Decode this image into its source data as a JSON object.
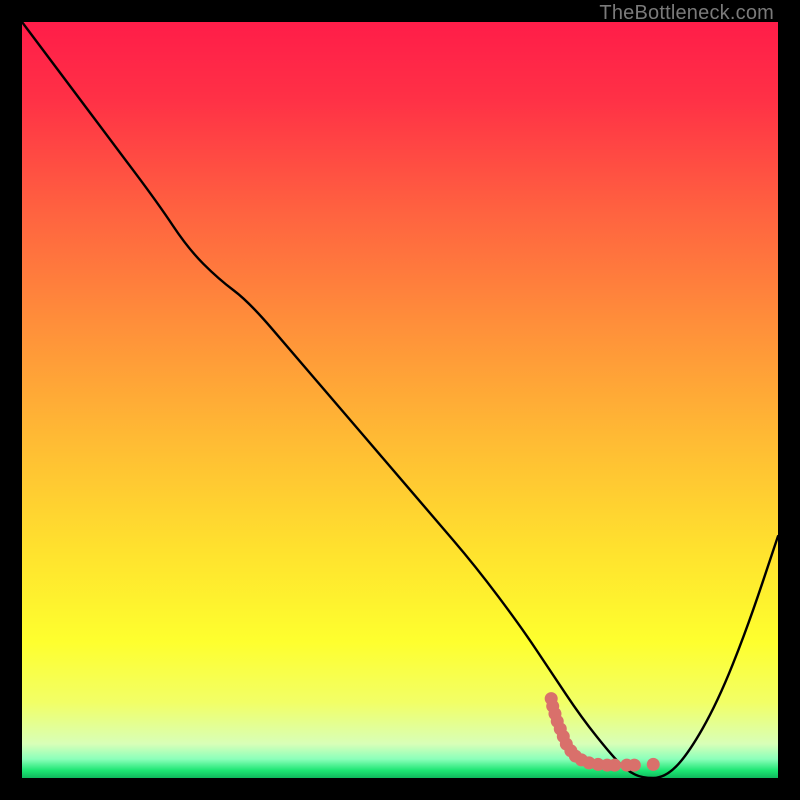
{
  "watermark": {
    "text": "TheBottleneck.com"
  },
  "chart_data": {
    "type": "line",
    "title": "",
    "xlabel": "",
    "ylabel": "",
    "xlim": [
      0,
      100
    ],
    "ylim": [
      0,
      100
    ],
    "grid": false,
    "legend": false,
    "series": [
      {
        "name": "bottleneck-curve",
        "x": [
          0,
          6,
          12,
          18,
          22,
          26,
          30,
          36,
          42,
          48,
          54,
          60,
          66,
          70,
          74,
          78,
          80,
          82,
          85,
          88,
          92,
          96,
          100
        ],
        "y": [
          100,
          92,
          84,
          76,
          70,
          66,
          63,
          56,
          49,
          42,
          35,
          28,
          20,
          14,
          8,
          3,
          1,
          0,
          0,
          3,
          10,
          20,
          32
        ]
      }
    ],
    "markers": {
      "name": "highlight-dots",
      "color": "#d9706b",
      "points": [
        {
          "x": 70.0,
          "y": 10.5
        },
        {
          "x": 70.2,
          "y": 9.5
        },
        {
          "x": 70.5,
          "y": 8.5
        },
        {
          "x": 70.8,
          "y": 7.5
        },
        {
          "x": 71.2,
          "y": 6.5
        },
        {
          "x": 71.6,
          "y": 5.5
        },
        {
          "x": 72.0,
          "y": 4.5
        },
        {
          "x": 72.6,
          "y": 3.6
        },
        {
          "x": 73.2,
          "y": 2.9
        },
        {
          "x": 74.0,
          "y": 2.4
        },
        {
          "x": 75.0,
          "y": 2.0
        },
        {
          "x": 76.2,
          "y": 1.8
        },
        {
          "x": 77.4,
          "y": 1.7
        },
        {
          "x": 78.4,
          "y": 1.7
        },
        {
          "x": 80.0,
          "y": 1.7
        },
        {
          "x": 81.0,
          "y": 1.7
        },
        {
          "x": 83.5,
          "y": 1.8
        }
      ]
    },
    "background_gradient": {
      "stops": [
        {
          "offset": 0.0,
          "color": "#ff1d49"
        },
        {
          "offset": 0.1,
          "color": "#ff3046"
        },
        {
          "offset": 0.25,
          "color": "#ff6240"
        },
        {
          "offset": 0.4,
          "color": "#ff8f3a"
        },
        {
          "offset": 0.55,
          "color": "#ffba34"
        },
        {
          "offset": 0.7,
          "color": "#ffe22e"
        },
        {
          "offset": 0.82,
          "color": "#feff2e"
        },
        {
          "offset": 0.9,
          "color": "#f2ff66"
        },
        {
          "offset": 0.955,
          "color": "#d8ffb8"
        },
        {
          "offset": 0.975,
          "color": "#8bffba"
        },
        {
          "offset": 0.99,
          "color": "#1de673"
        },
        {
          "offset": 1.0,
          "color": "#0fb85c"
        }
      ]
    }
  }
}
